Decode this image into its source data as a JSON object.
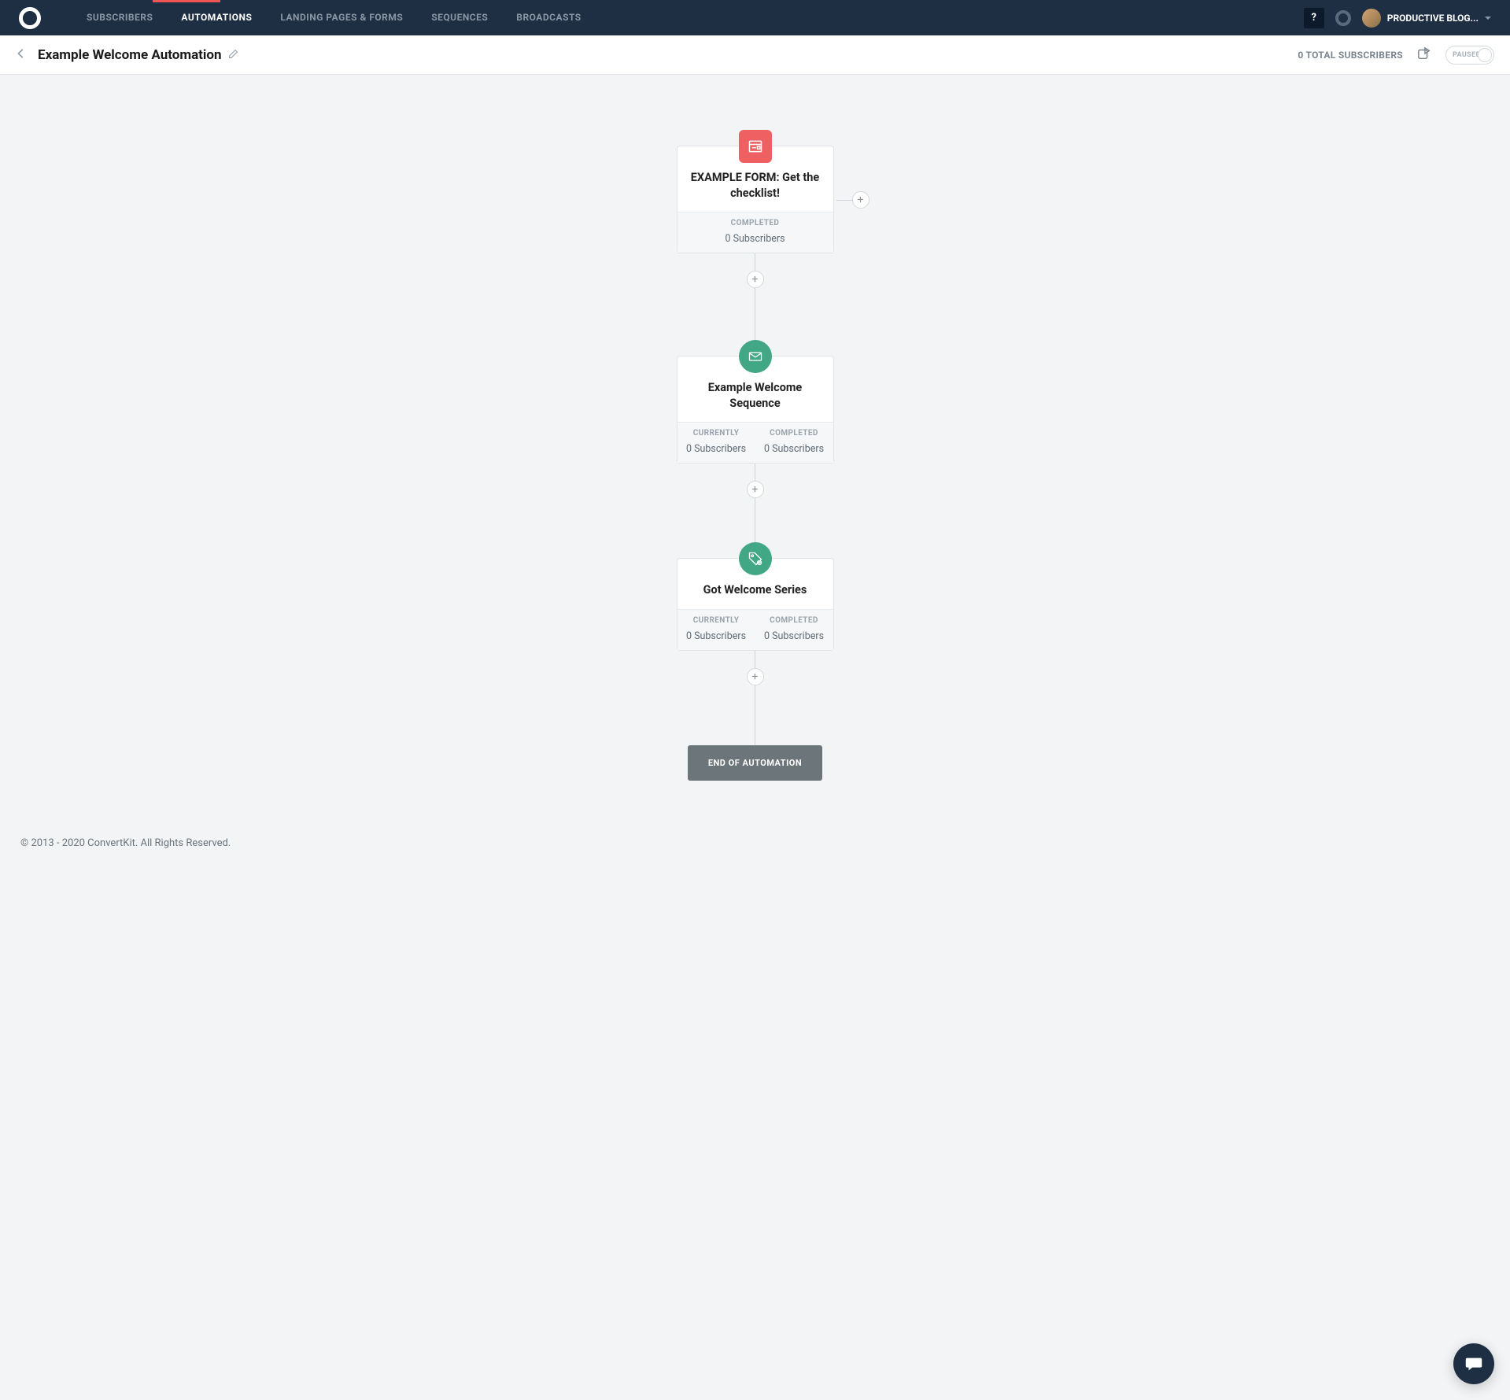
{
  "nav": {
    "items": [
      "SUBSCRIBERS",
      "AUTOMATIONS",
      "LANDING PAGES & FORMS",
      "SEQUENCES",
      "BROADCASTS"
    ],
    "active_index": 1,
    "help": "?",
    "user_name": "PRODUCTIVE BLOG..."
  },
  "subheader": {
    "title": "Example Welcome Automation",
    "total_subs": "0 TOTAL SUBSCRIBERS",
    "status_label": "PAUSED"
  },
  "nodes": {
    "form": {
      "title": "EXAMPLE FORM: Get the checklist!",
      "completed_label": "COMPLETED",
      "completed_value": "0 Subscribers"
    },
    "sequence": {
      "title": "Example Welcome Sequence",
      "currently_label": "CURRENTLY",
      "currently_value": "0 Subscribers",
      "completed_label": "COMPLETED",
      "completed_value": "0 Subscribers"
    },
    "tag": {
      "title": "Got Welcome Series",
      "currently_label": "CURRENTLY",
      "currently_value": "0 Subscribers",
      "completed_label": "COMPLETED",
      "completed_value": "0 Subscribers"
    },
    "end": "END OF AUTOMATION"
  },
  "footer": "© 2013 - 2020 ConvertKit. All Rights Reserved.",
  "colors": {
    "brand_red": "#ef6062",
    "brand_green": "#41a785",
    "nav_bg": "#1e2f44"
  }
}
